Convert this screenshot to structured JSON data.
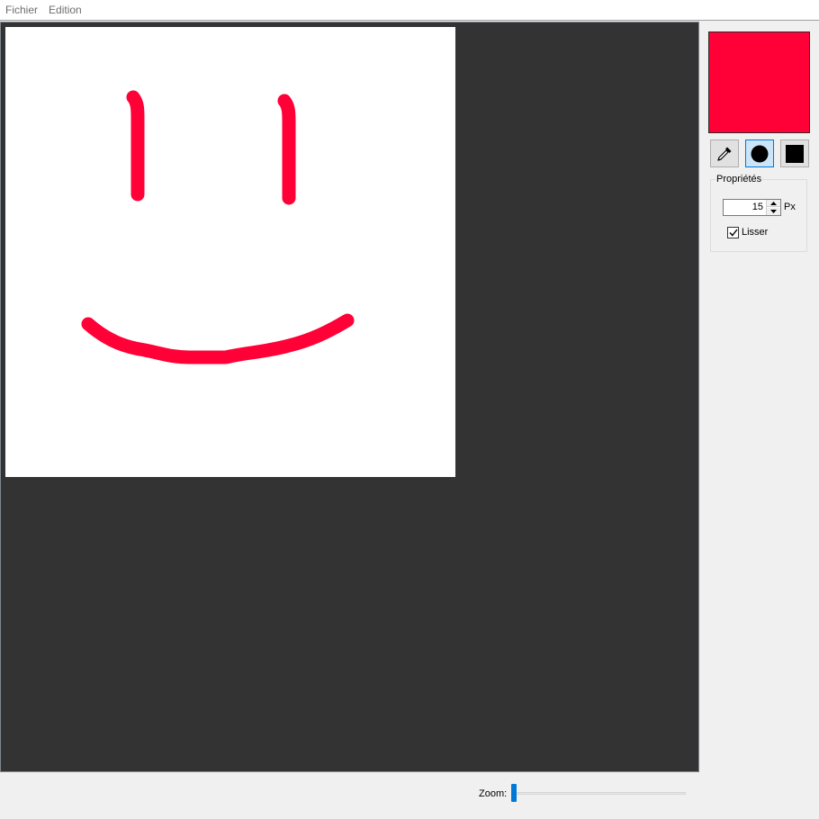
{
  "menubar": {
    "items": [
      "Fichier",
      "Edition"
    ]
  },
  "brush": {
    "color": "#ff0037"
  },
  "tools": [
    {
      "name": "eyedropper",
      "icon": "eyedropper-icon",
      "active": false
    },
    {
      "name": "round-brush",
      "icon": "circle-icon",
      "active": true
    },
    {
      "name": "square-brush",
      "icon": "square-icon",
      "active": false
    }
  ],
  "properties": {
    "title": "Propriétés",
    "size_value": "15",
    "size_unit": "Px",
    "smooth_label": "Lisser",
    "smooth_checked": true
  },
  "status": {
    "zoom_label": "Zoom:",
    "zoom_fraction": 0.0
  },
  "colors": {
    "viewport_bg": "#333333",
    "canvas_bg": "#ffffff",
    "accent": "#0078d7"
  }
}
